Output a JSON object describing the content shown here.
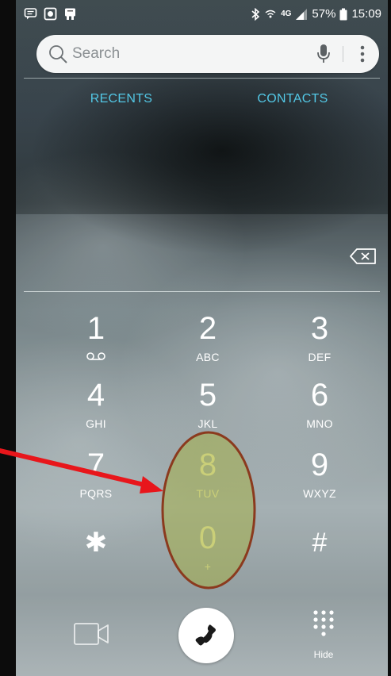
{
  "status_bar": {
    "battery": "57%",
    "time": "15:09",
    "network": "4G"
  },
  "search": {
    "placeholder": "Search"
  },
  "tabs": [
    {
      "label": "RECENTS"
    },
    {
      "label": "CONTACTS"
    }
  ],
  "keypad": [
    {
      "digit": "1",
      "letters": ""
    },
    {
      "digit": "2",
      "letters": "ABC"
    },
    {
      "digit": "3",
      "letters": "DEF"
    },
    {
      "digit": "4",
      "letters": "GHI"
    },
    {
      "digit": "5",
      "letters": "JKL"
    },
    {
      "digit": "6",
      "letters": "MNO"
    },
    {
      "digit": "7",
      "letters": "PQRS"
    },
    {
      "digit": "8",
      "letters": "TUV"
    },
    {
      "digit": "9",
      "letters": "WXYZ"
    },
    {
      "digit": "✱",
      "letters": ""
    },
    {
      "digit": "0",
      "letters": "+"
    },
    {
      "digit": "#",
      "letters": ""
    }
  ],
  "bottom_bar": {
    "hide_label": "Hide"
  },
  "annotation": {
    "highlight_color": "#8b3a1e",
    "highlight_fill": "#a6b04a",
    "arrow_color": "#e8161b"
  },
  "colors": {
    "tab_accent": "#53c8e6",
    "key_text": "#ffffff",
    "highlighted_key_text": "#f6f3b0"
  }
}
